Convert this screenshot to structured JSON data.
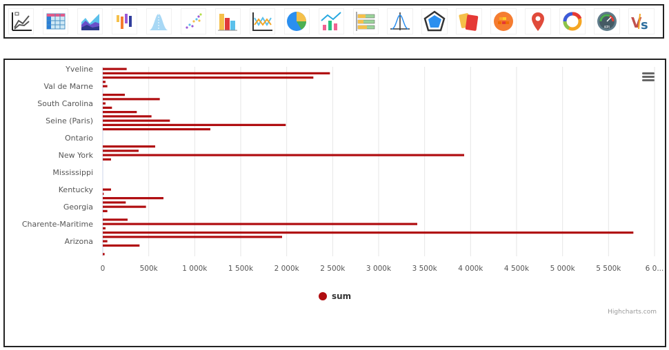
{
  "toolbar": {
    "icons": [
      {
        "name": "line-chart-icon"
      },
      {
        "name": "table-icon"
      },
      {
        "name": "area-chart-icon"
      },
      {
        "name": "candlestick-icon"
      },
      {
        "name": "bell-curve-icon"
      },
      {
        "name": "scatter-chart-icon"
      },
      {
        "name": "bar-chart-icon"
      },
      {
        "name": "multi-line-chart-icon"
      },
      {
        "name": "pie-chart-icon"
      },
      {
        "name": "combo-chart-icon"
      },
      {
        "name": "stacked-bar-icon"
      },
      {
        "name": "distribution-icon"
      },
      {
        "name": "radar-chart-icon"
      },
      {
        "name": "cards-icon"
      },
      {
        "name": "heatmap-icon"
      },
      {
        "name": "map-pin-icon"
      },
      {
        "name": "donut-chart-icon"
      },
      {
        "name": "kpi-gauge-icon"
      },
      {
        "name": "versus-icon"
      }
    ]
  },
  "chart": {
    "menu_icon": "hamburger-menu-icon",
    "credits": "Highcharts.com",
    "legend_label": "sum",
    "series_color": "#b00d10"
  },
  "chart_data": {
    "type": "bar",
    "orientation": "horizontal",
    "title": "",
    "xlabel": "",
    "ylabel": "",
    "series": [
      {
        "name": "sum",
        "values": [
          260000,
          2470000,
          2290000,
          30000,
          50000,
          0,
          240000,
          620000,
          30000,
          100000,
          370000,
          530000,
          730000,
          1990000,
          1170000,
          0,
          0,
          0,
          570000,
          390000,
          3930000,
          90000,
          0,
          0,
          0,
          0,
          0,
          0,
          90000,
          10000,
          660000,
          250000,
          470000,
          50000,
          0,
          270000,
          3420000,
          30000,
          5770000,
          1950000,
          50000,
          400000,
          0,
          20000
        ]
      }
    ],
    "category_labels_shown": [
      "Yveline",
      "Val de Marne",
      "South Carolina",
      "Seine (Paris)",
      "Ontario",
      "New York",
      "Mississippi",
      "Kentucky",
      "Georgia",
      "Charente-Maritime",
      "Arizona"
    ],
    "value_axis": {
      "min": 0,
      "max": 6000000,
      "tick_interval": 500000,
      "tick_labels": [
        "0",
        "500k",
        "1 000k",
        "1 500k",
        "2 000k",
        "2 500k",
        "3 000k",
        "3 500k",
        "4 000k",
        "4 500k",
        "5 000k",
        "5 500k",
        "6 0..."
      ]
    },
    "grid": true,
    "legend_position": "bottom-center"
  }
}
